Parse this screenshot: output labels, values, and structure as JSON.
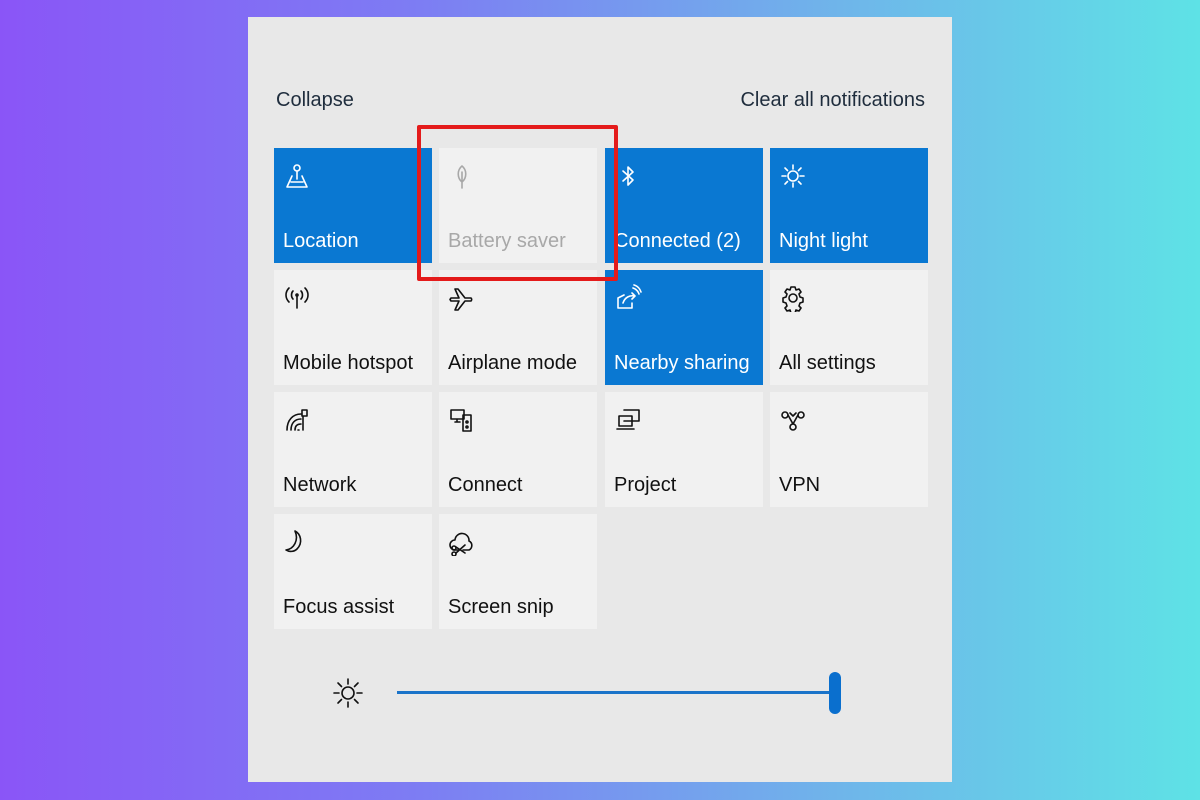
{
  "header": {
    "collapse_label": "Collapse",
    "clear_label": "Clear all notifications"
  },
  "tiles": [
    {
      "label": "Location",
      "icon": "location-icon",
      "state": "on"
    },
    {
      "label": "Battery saver",
      "icon": "leaf-icon",
      "state": "disabled"
    },
    {
      "label": "Connected (2)",
      "icon": "bluetooth-icon",
      "state": "on"
    },
    {
      "label": "Night light",
      "icon": "night-light-icon",
      "state": "on"
    },
    {
      "label": "Mobile hotspot",
      "icon": "hotspot-icon",
      "state": "off"
    },
    {
      "label": "Airplane mode",
      "icon": "airplane-icon",
      "state": "off"
    },
    {
      "label": "Nearby sharing",
      "icon": "nearby-sharing-icon",
      "state": "on"
    },
    {
      "label": "All settings",
      "icon": "gear-icon",
      "state": "off"
    },
    {
      "label": "Network",
      "icon": "network-icon",
      "state": "off"
    },
    {
      "label": "Connect",
      "icon": "connect-icon",
      "state": "off"
    },
    {
      "label": "Project",
      "icon": "project-icon",
      "state": "off"
    },
    {
      "label": "VPN",
      "icon": "vpn-icon",
      "state": "off"
    },
    {
      "label": "Focus assist",
      "icon": "moon-icon",
      "state": "off"
    },
    {
      "label": "Screen snip",
      "icon": "screen-snip-icon",
      "state": "off"
    }
  ],
  "brightness": {
    "icon": "sun-icon",
    "value_percent": 100
  },
  "colors": {
    "accent": "#0a78d2",
    "highlight": "#e41b1b",
    "tile_off": "#f1f1f1",
    "panel": "#e8e8e8"
  },
  "annotation": {
    "highlighted_tile": "Battery saver"
  }
}
